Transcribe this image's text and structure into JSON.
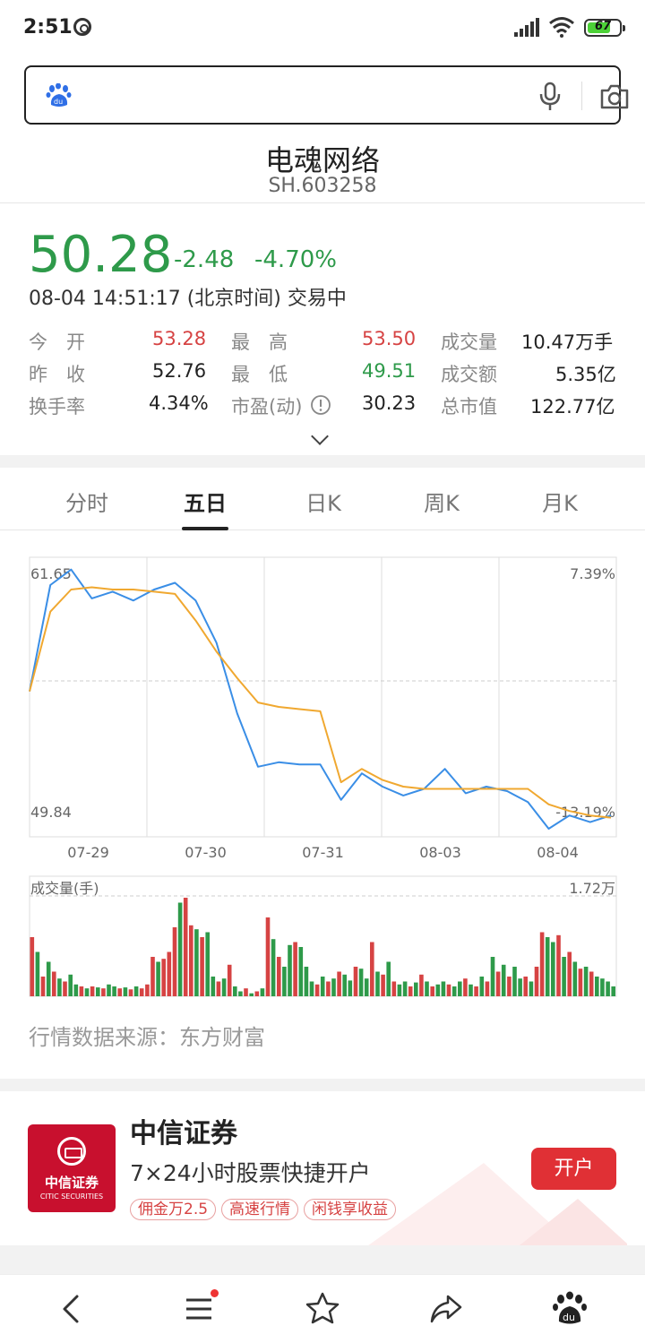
{
  "status_bar": {
    "time": "2:51",
    "battery": "67"
  },
  "search": {
    "placeholder": ""
  },
  "stock": {
    "name": "电魂网络",
    "code": "SH.603258",
    "price": "50.28",
    "change": "-2.48",
    "change_pct": "-4.70%",
    "time": "08-04 14:51:17 (北京时间) 交易中"
  },
  "stats": [
    [
      {
        "label": "今　开",
        "value": "53.28",
        "color": "red"
      },
      {
        "label": "最　高",
        "value": "53.50",
        "color": "red"
      },
      {
        "label": "成交量",
        "value": "10.47万手",
        "color": "dark"
      }
    ],
    [
      {
        "label": "昨　收",
        "value": "52.76",
        "color": "dark"
      },
      {
        "label": "最　低",
        "value": "49.51",
        "color": "green"
      },
      {
        "label": "成交额",
        "value": "5.35亿",
        "color": "dark"
      }
    ],
    [
      {
        "label": "换手率",
        "value": "4.34%",
        "color": "dark"
      },
      {
        "label": "市盈(动)",
        "value": "30.23",
        "color": "dark"
      },
      {
        "label": "总市值",
        "value": "122.77亿",
        "color": "dark"
      }
    ]
  ],
  "tabs": [
    "分时",
    "五日",
    "日K",
    "周K",
    "月K"
  ],
  "active_tab": "五日",
  "chart_labels": {
    "price_high": "61.65",
    "price_low": "49.84",
    "pct_high": "7.39%",
    "pct_low": "-13.19%",
    "volume_title": "成交量(手)",
    "volume_max": "1.72万"
  },
  "colors": {
    "up": "#d64343",
    "down": "#2e9a4a",
    "price_line": "#3a8ee6",
    "avg_line": "#f0a830",
    "ad_red": "#e03035"
  },
  "chart_data": {
    "type": "line",
    "x": [
      "07-29",
      "07-30",
      "07-31",
      "08-03",
      "08-04"
    ],
    "ylim": [
      49.84,
      61.65
    ],
    "y2lim": [
      "-13.19%",
      "7.39%"
    ],
    "series": [
      {
        "values": [
          56.0,
          60.8,
          61.5,
          60.2,
          60.5,
          60.1,
          60.6,
          60.9,
          60.1,
          58.2,
          55.0,
          52.6,
          52.8,
          52.7,
          52.7,
          51.1,
          52.3,
          51.7,
          51.3,
          51.6,
          52.5,
          51.4,
          51.7,
          51.5,
          51.0,
          49.8,
          50.4,
          50.1,
          50.4
        ]
      },
      {
        "values": [
          56.0,
          59.6,
          60.6,
          60.7,
          60.6,
          60.6,
          60.5,
          60.4,
          59.2,
          57.8,
          56.6,
          55.5,
          55.3,
          55.2,
          55.1,
          51.9,
          52.5,
          52.0,
          51.7,
          51.6,
          51.6,
          51.6,
          51.6,
          51.6,
          51.6,
          50.9,
          50.6,
          50.4,
          50.3
        ]
      }
    ]
  },
  "volume_data": [
    {
      "values": [
        60,
        45,
        20,
        35,
        25,
        18,
        15,
        22,
        12,
        10,
        8,
        10,
        9,
        8,
        12,
        10,
        8,
        9,
        7,
        10,
        8,
        12,
        40,
        35,
        38,
        45,
        70,
        95,
        100,
        72,
        68,
        60,
        65,
        20,
        15,
        18,
        32,
        10,
        5,
        8,
        3,
        5,
        8,
        80,
        58,
        40,
        30,
        52,
        55,
        50,
        30,
        15,
        12,
        20,
        15,
        18,
        25,
        22,
        16,
        30,
        28,
        18,
        55,
        25,
        22,
        35,
        15,
        12,
        15,
        10,
        14,
        22,
        15,
        10,
        12,
        15,
        12,
        10,
        15,
        18,
        12,
        10,
        20,
        15,
        40,
        25,
        32,
        20,
        30,
        18,
        20,
        15,
        30,
        65,
        60,
        55,
        62,
        40,
        45,
        35,
        28,
        30,
        25,
        20,
        18,
        15,
        10
      ],
      "colors": [
        "r",
        "g",
        "r",
        "g",
        "r",
        "g",
        "r",
        "g",
        "g",
        "r",
        "g",
        "r",
        "g",
        "r",
        "g",
        "g",
        "r",
        "g",
        "r",
        "g",
        "r",
        "r",
        "r",
        "g",
        "r",
        "r",
        "r",
        "g",
        "r",
        "r",
        "g",
        "r",
        "g",
        "g",
        "r",
        "g",
        "r",
        "g",
        "g",
        "r",
        "g",
        "r",
        "g",
        "r",
        "g",
        "r",
        "g",
        "g",
        "r",
        "g",
        "g",
        "g",
        "r",
        "g",
        "r",
        "g",
        "r",
        "g",
        "g",
        "r",
        "g",
        "g",
        "r",
        "g",
        "r",
        "g",
        "r",
        "g",
        "g",
        "r",
        "g",
        "r",
        "g",
        "r",
        "g",
        "g",
        "r",
        "g",
        "g",
        "r",
        "g",
        "r",
        "g",
        "r",
        "g",
        "r",
        "g",
        "r",
        "g",
        "g",
        "r",
        "g",
        "r",
        "r",
        "g",
        "g",
        "r",
        "g",
        "r",
        "g",
        "r",
        "g",
        "r",
        "g",
        "g",
        "g",
        "g"
      ]
    }
  ],
  "source_text": "行情数据来源：东方财富",
  "ad": {
    "title": "中信证券",
    "subtitle": "7×24小时股票快捷开户",
    "logo_cn": "中信证券",
    "logo_en": "CITIC SECURITIES",
    "chips": [
      "佣金万2.5",
      "高速行情",
      "闲钱享收益"
    ],
    "button": "开户"
  },
  "nav": [
    "back-icon",
    "menu-icon",
    "star-icon",
    "share-icon",
    "baidu-paw-icon"
  ]
}
